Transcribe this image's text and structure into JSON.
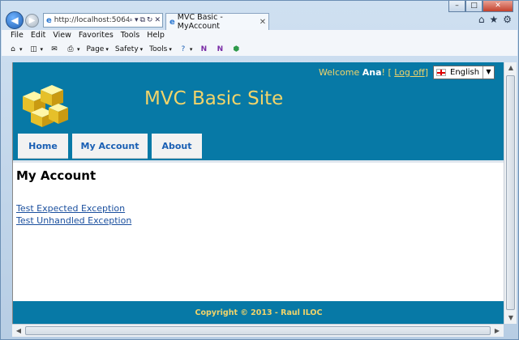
{
  "browser": {
    "address": "http://localhost:5064/",
    "tab_title": "MVC Basic - MyAccount",
    "menu": [
      "File",
      "Edit",
      "View",
      "Favorites",
      "Tools",
      "Help"
    ],
    "commands": {
      "page": "Page",
      "safety": "Safety",
      "tools": "Tools"
    }
  },
  "site": {
    "welcome_prefix": "Welcome",
    "username": "Ana",
    "welcome_suffix": "! [",
    "logoff_label": "Log off",
    "welcome_close": "]",
    "language": "English",
    "title": "MVC Basic Site",
    "nav": [
      {
        "label": "Home"
      },
      {
        "label": "My Account"
      },
      {
        "label": "About"
      }
    ]
  },
  "content": {
    "heading": "My Account",
    "links": [
      {
        "label": "Test Expected Exception"
      },
      {
        "label": "Test Unhandled Exception"
      }
    ]
  },
  "footer": {
    "text": "Copyright © 2013 - Raul ILOC"
  },
  "colors": {
    "header_bg": "#0779a6",
    "accent_yellow": "#f1d46a",
    "link_blue": "#1a4f9e"
  }
}
